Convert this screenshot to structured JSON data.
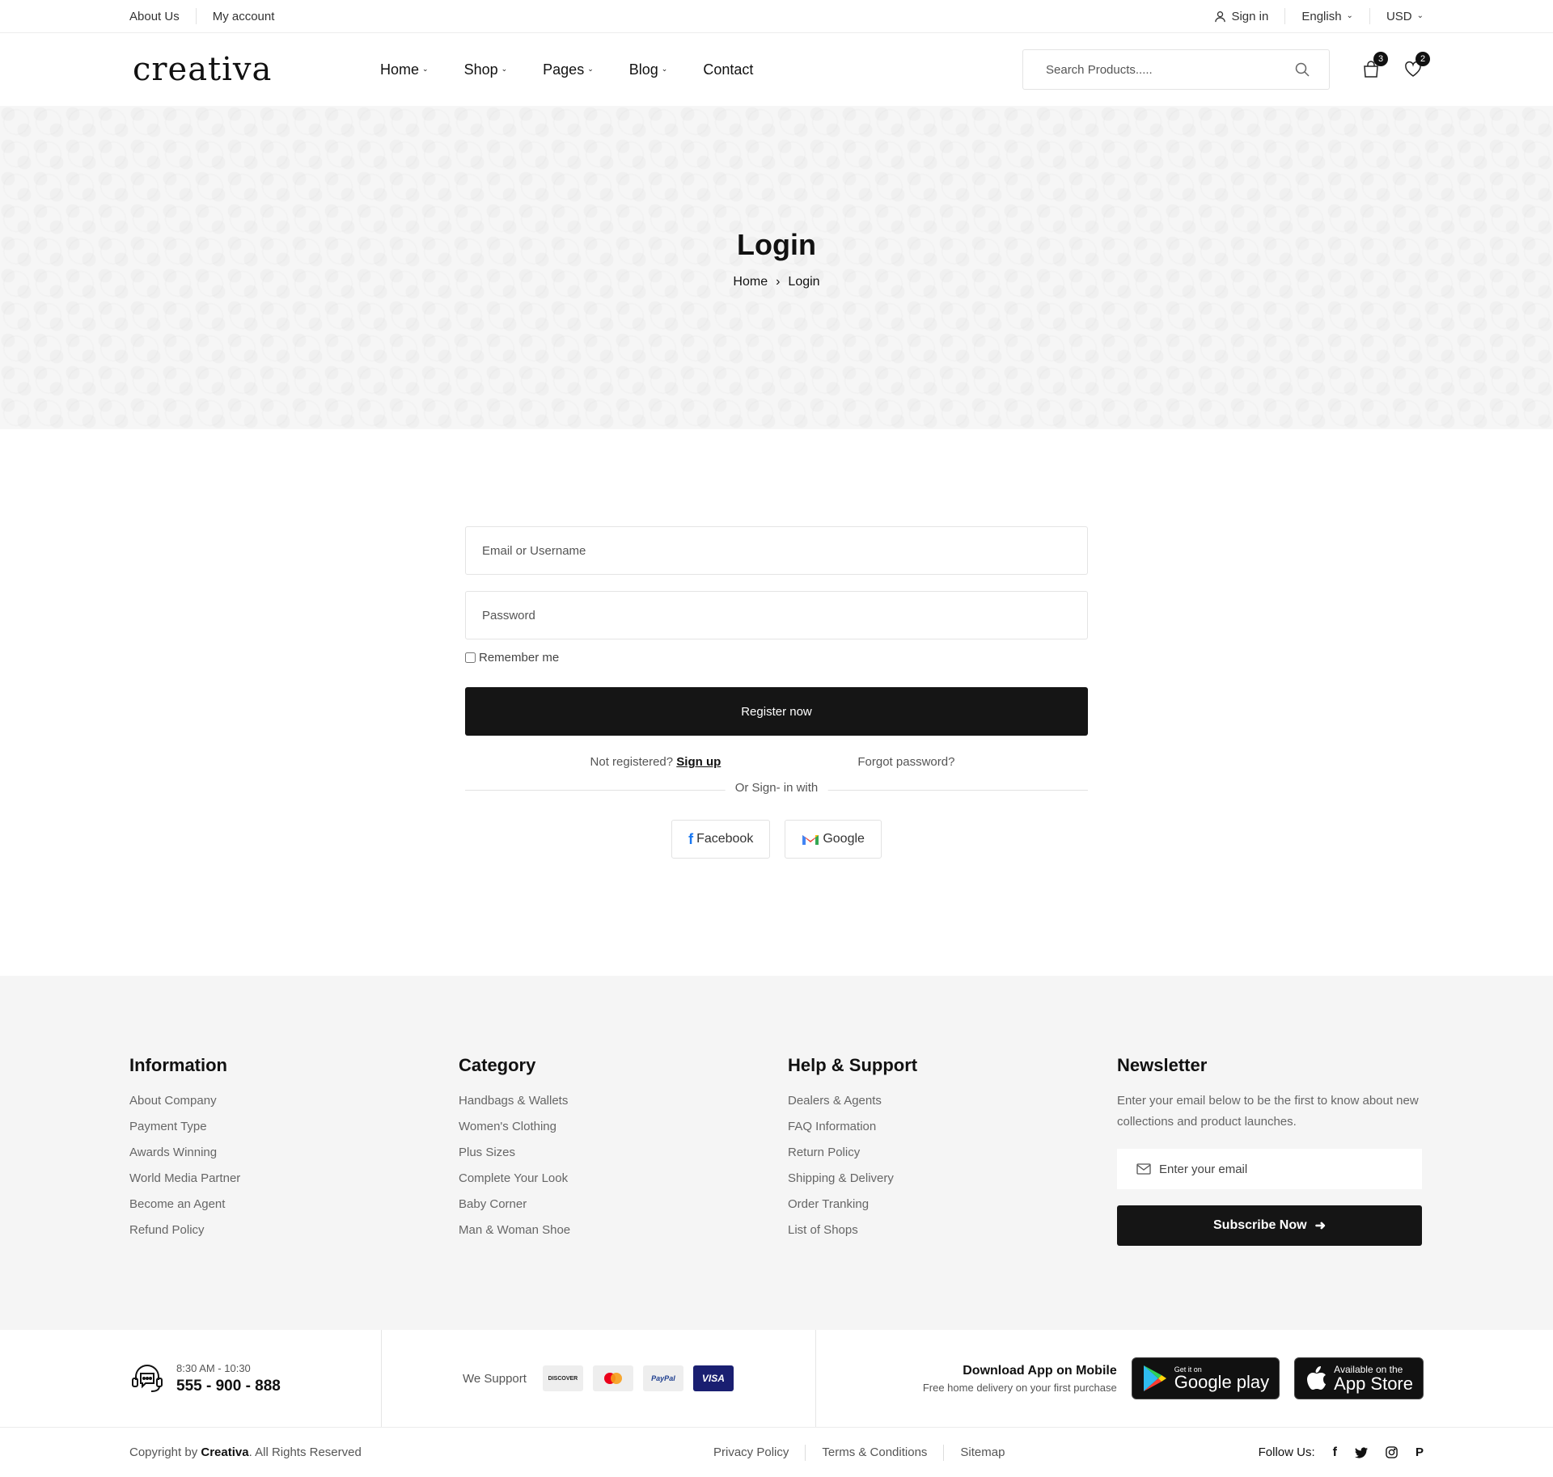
{
  "topbar": {
    "left": [
      "About Us",
      "My account"
    ],
    "sign_in": "Sign in",
    "language": "English",
    "currency": "USD"
  },
  "header": {
    "logo": "creativa",
    "nav": [
      "Home",
      "Shop",
      "Pages",
      "Blog",
      "Contact"
    ],
    "search_placeholder": "Search Products.....",
    "cart_count": "3",
    "wishlist_count": "2"
  },
  "banner": {
    "title": "Login",
    "breadcrumb": [
      "Home",
      "Login"
    ]
  },
  "login": {
    "email_placeholder": "Email or Username",
    "password_placeholder": "Password",
    "remember": "Remember me",
    "submit": "Register now",
    "not_registered": "Not registered?",
    "sign_up": "Sign up",
    "forgot": "Forgot password?",
    "or_sign_in": "Or Sign- in with",
    "facebook": "Facebook",
    "google": "Google"
  },
  "footer": {
    "information": {
      "title": "Information",
      "items": [
        "About Company",
        "Payment Type",
        "Awards Winning",
        "World Media Partner",
        "Become an Agent",
        "Refund Policy"
      ]
    },
    "category": {
      "title": "Category",
      "items": [
        "Handbags & Wallets",
        "Women's Clothing",
        "Plus Sizes",
        "Complete Your Look",
        "Baby Corner",
        "Man & Woman Shoe"
      ]
    },
    "help": {
      "title": "Help & Support",
      "items": [
        "Dealers & Agents",
        "FAQ Information",
        "Return Policy",
        "Shipping & Delivery",
        "Order Tranking",
        "List of Shops"
      ]
    },
    "newsletter": {
      "title": "Newsletter",
      "text": "Enter your email below to be the first to know about new collections and product launches.",
      "placeholder": "Enter your email",
      "button": "Subscribe Now"
    }
  },
  "strip": {
    "hours": "8:30 AM - 10:30",
    "phone": "555 - 900 - 888",
    "we_support": "We Support",
    "payments": [
      "DISCOVER",
      "Mastercard",
      "PayPal",
      "VISA"
    ],
    "app_title": "Download App on Mobile",
    "app_sub": "Free home delivery on your first purchase",
    "google_small": "Get it on",
    "google_big": "Google play",
    "apple_small": "Available on the",
    "apple_big": "App Store"
  },
  "bottom": {
    "copyright_prefix": "Copyright by",
    "brand": "Creativa",
    "copyright_suffix": ". All Rights Reserved",
    "links": [
      "Privacy Policy",
      "Terms & Conditions",
      "Sitemap"
    ],
    "follow": "Follow Us:"
  }
}
